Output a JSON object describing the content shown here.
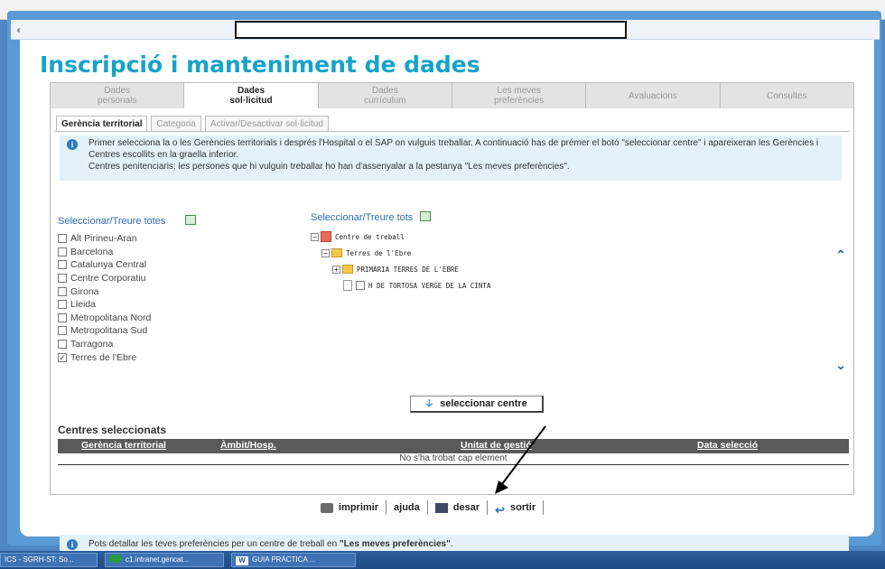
{
  "page_title": "Inscripció i manteniment de dades",
  "main_tabs": [
    {
      "line1": "Dades",
      "line2": "personals",
      "active": false
    },
    {
      "line1": "Dades",
      "line2": "sol·licitud",
      "active": true
    },
    {
      "line1": "Dades",
      "line2": "currículum",
      "active": false
    },
    {
      "line1": "Les meves",
      "line2": "preferències",
      "active": false
    },
    {
      "line1": "Avaluacions",
      "line2": "",
      "active": false
    },
    {
      "line1": "Consultes",
      "line2": "",
      "active": false
    }
  ],
  "sub_tabs": [
    "Gerència territorial",
    "Categoria",
    "Activar/Desactivar sol·licitud"
  ],
  "info": {
    "icon": "info-icon",
    "line1": "Primer selecciona la o les Gerències territorials i després l'Hospital o el SAP on vulguis treballar. A continuació has de prémer el botó \"seleccionar centre\" i apareixeran les Gerències i Centres escollits en la graella inferior.",
    "line2": "Centres penitenciaris: les persones que hi vulguin treballar ho han d'assenyalar a la pestanya \"Les meves preferències\"."
  },
  "left_panel": {
    "toggle_label": "Seleccionar/Treure totes",
    "items": [
      {
        "label": "Alt Pirineu-Aran",
        "checked": false
      },
      {
        "label": "Barcelona",
        "checked": false
      },
      {
        "label": "Catalunya Central",
        "checked": false
      },
      {
        "label": "Centre Corporatiu",
        "checked": false
      },
      {
        "label": "Girona",
        "checked": false
      },
      {
        "label": "Lleida",
        "checked": false
      },
      {
        "label": "Metropolitana Nord",
        "checked": false
      },
      {
        "label": "Metropolitana Sud",
        "checked": false
      },
      {
        "label": "Tarragona",
        "checked": false
      },
      {
        "label": "Terres de l'Ebre",
        "checked": true
      }
    ]
  },
  "right_panel": {
    "toggle_label": "Seleccionar/Treure tots",
    "tree": {
      "root": "Centre de treball",
      "level1": "Terres de l'Ebre",
      "level2": "PRIMÀRIA TERRES DE L'EBRE",
      "leaf": "H DE TORTOSA VERGE DE LA CINTA"
    }
  },
  "select_button": "seleccionar centre",
  "selected_centres": {
    "title": "Centres seleccionats",
    "columns": [
      "Gerència territorial",
      "Àmbit/Hosp.",
      "Unitat de gestió",
      "Data selecció"
    ],
    "empty_message": "No s'ha trobat cap element"
  },
  "bottom_info": {
    "prefix": "Pots detallar les teves preferències per un centre de treball en ",
    "highlight": "\"Les meves preferències\"",
    "suffix": "."
  },
  "actions": [
    "imprimir",
    "ajuda",
    "desar",
    "sortir"
  ],
  "taskbar": [
    "ICS - SGRH-ST: So...",
    "c1.intranet.gencat...",
    "GUIA PRÀCTICA ..."
  ],
  "colors": {
    "title": "#16a3c9",
    "link": "#2b6cb0",
    "info_bg": "#e4f1f8",
    "grid_header": "#5a5a5a"
  }
}
